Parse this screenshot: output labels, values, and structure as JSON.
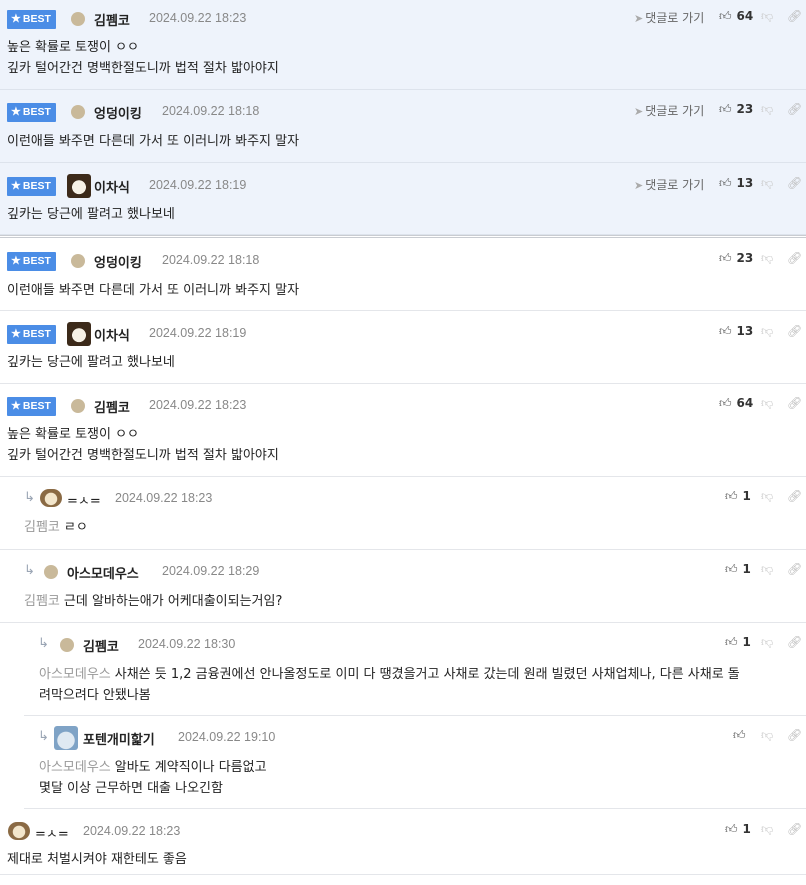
{
  "labels": {
    "best": "BEST",
    "goto": "댓글로 가기"
  },
  "best_comments": [
    {
      "author": "김펨코",
      "date": "2024.09.22 18:23",
      "likes": "64",
      "lines": [
        "높은 확률로 토쟁이 ㅇㅇ",
        "깊카 털어간건 명백한절도니까 법적 절차 밟아야지"
      ]
    },
    {
      "author": "엉덩이킹",
      "date": "2024.09.22 18:18",
      "likes": "23",
      "lines": [
        "이런애들 봐주면 다른데 가서 또 이러니까 봐주지 말자"
      ]
    },
    {
      "author": "이차식",
      "date": "2024.09.22 18:19",
      "likes": "13",
      "lines": [
        "깊카는 당근에 팔려고 했나보네"
      ]
    }
  ],
  "comments": [
    {
      "author": "엉덩이킹",
      "date": "2024.09.22 18:18",
      "likes": "23",
      "lines": [
        "이런애들 봐주면 다른데 가서 또 이러니까 봐주지 말자"
      ]
    },
    {
      "author": "이차식",
      "date": "2024.09.22 18:19",
      "likes": "13",
      "lines": [
        "깊카는 당근에 팔려고 했나보네"
      ]
    },
    {
      "author": "김펨코",
      "date": "2024.09.22 18:23",
      "likes": "64",
      "lines": [
        "높은 확률로 토쟁이 ㅇㅇ",
        "깊카 털어간건 명백한절도니까 법적 절차 밟아야지"
      ]
    }
  ],
  "replies": [
    {
      "author": "=ㅅ=",
      "date": "2024.09.22 18:23",
      "likes": "1",
      "mention": "김펨코",
      "text": "ㄹㅇ"
    },
    {
      "author": "아스모데우스",
      "date": "2024.09.22 18:29",
      "likes": "1",
      "mention": "김펨코",
      "text": "근데 알바하는애가 어케대출이되는거임?"
    },
    {
      "author": "김펨코",
      "date": "2024.09.22 18:30",
      "likes": "1",
      "mention": "아스모데우스",
      "text": "사채쓴 듯 1,2 금융권에선 안나올정도로 이미 다 땡겼을거고 사채로 갔는데 원래 빌렸던 사채업체나, 다른 사채로 돌",
      "text2": "려막으려다 안됐나봄"
    },
    {
      "author": "포텐개미핥기",
      "date": "2024.09.22 19:10",
      "likes": "",
      "mention": "아스모데우스",
      "text": "알바도 계약직이나 다름없고",
      "text2": "몇달 이상 근무하면 대출 나오긴함"
    },
    {
      "author": "=ㅅ=",
      "date": "2024.09.22 18:23",
      "likes": "1",
      "text": "제대로 처벌시켜야 재한테도 좋음"
    }
  ]
}
